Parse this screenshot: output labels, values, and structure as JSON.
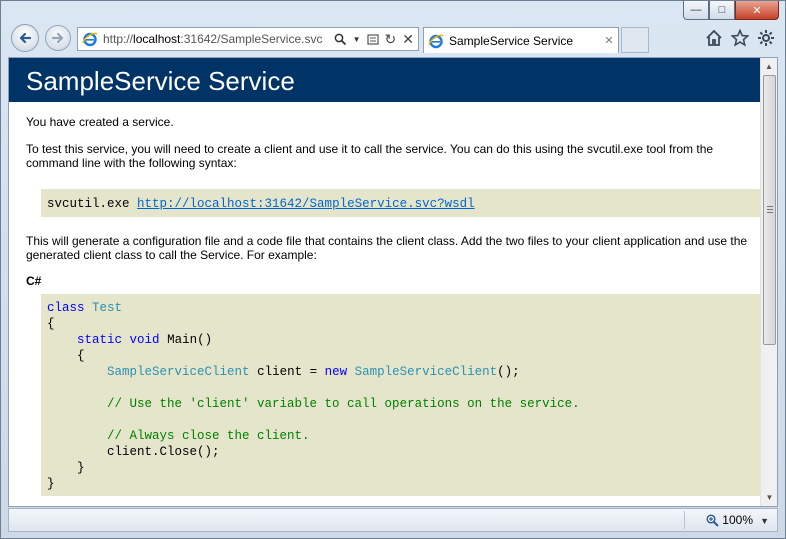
{
  "browser": {
    "address": {
      "prefix": "http://",
      "host": "localhost",
      "rest": ":31642/SampleService.svc"
    },
    "tab": {
      "title": "SampleService Service"
    },
    "zoom": "100%"
  },
  "page": {
    "heading": "SampleService Service",
    "intro": "You have created a service.",
    "instructions": "To test this service, you will need to create a client and use it to call the service. You can do this using the svcutil.exe tool from the command line with the following syntax:",
    "command": {
      "tool": "svcutil.exe",
      "url": "http://localhost:31642/SampleService.svc?wsdl"
    },
    "generate_text": "This will generate a configuration file and a code file that contains the client class. Add the two files to your client application and use the generated client class to call the Service. For example:",
    "language_label": "C#",
    "code": {
      "line1_kw": "class",
      "line1_type": "Test",
      "line2": "{",
      "line3_kw1": "static",
      "line3_kw2": "void",
      "line3_rest": "Main()",
      "line4": "{",
      "line5_type": "SampleServiceClient",
      "line5_mid": "client = ",
      "line5_kw": "new",
      "line5_type2": "SampleServiceClient",
      "line5_end": "();",
      "line6_comment": "// Use the 'client' variable to call operations on the service.",
      "line7_comment": "// Always close the client.",
      "line8": "client.Close();",
      "line9": "}",
      "line10": "}"
    }
  },
  "icons": {
    "back": "back-arrow-icon",
    "forward": "forward-arrow-icon",
    "home": "home-icon",
    "favorites": "star-icon",
    "tools": "gear-icon"
  },
  "colors": {
    "heading_bg": "#003366",
    "code_bg": "#e5e5cc",
    "keyword": "#0000ff",
    "type": "#2b91af",
    "comment": "#008000"
  }
}
